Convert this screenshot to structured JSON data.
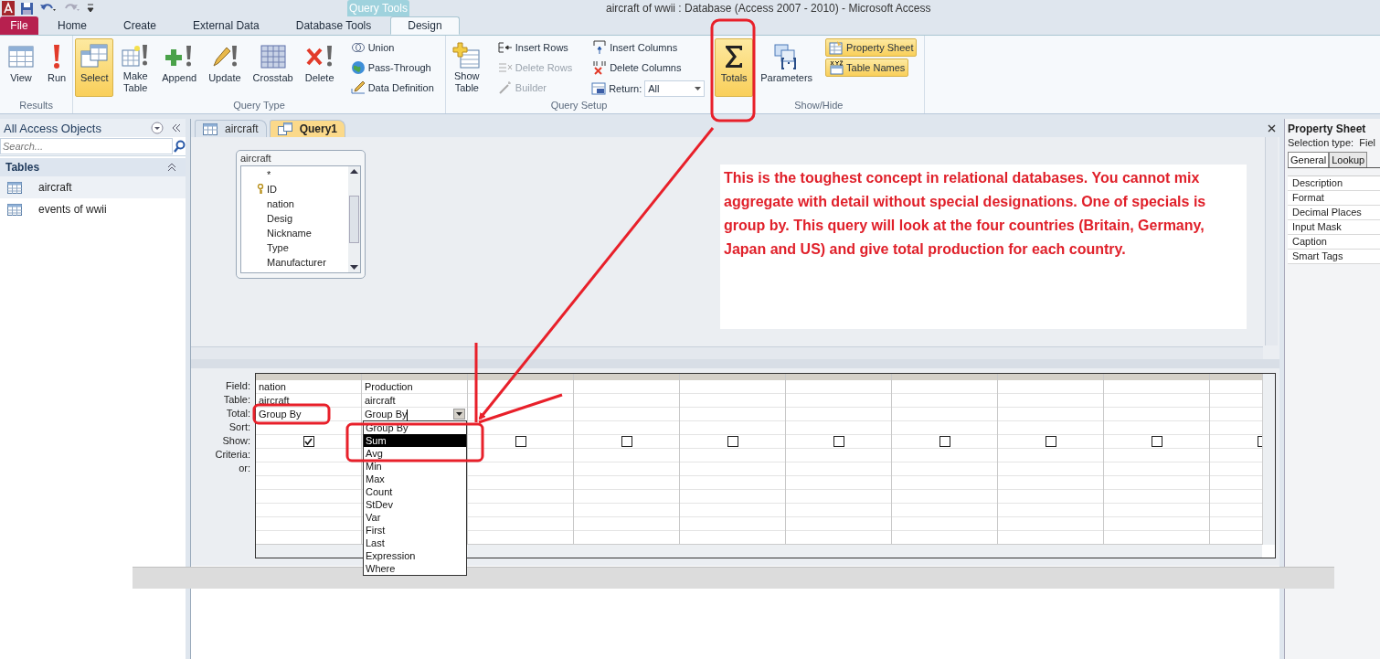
{
  "title_bar": {
    "contextual_tab": "Query Tools",
    "title": "aircraft of wwii : Database (Access 2007 - 2010)  -  Microsoft Access"
  },
  "ribbon_tabs": [
    {
      "label": "File",
      "kind": "file",
      "selected": false
    },
    {
      "label": "Home",
      "kind": "tab",
      "selected": false
    },
    {
      "label": "Create",
      "kind": "tab",
      "selected": false
    },
    {
      "label": "External Data",
      "kind": "tab",
      "selected": false
    },
    {
      "label": "Database Tools",
      "kind": "tab",
      "selected": false
    },
    {
      "label": "Design",
      "kind": "tab",
      "selected": true
    }
  ],
  "ribbon_groups": [
    {
      "label": "Results",
      "large": [
        {
          "label": "View",
          "on": false
        },
        {
          "label": "Run",
          "on": false
        }
      ]
    },
    {
      "label": "Query Type",
      "large": [
        {
          "label": "Select",
          "on": true
        },
        {
          "label": "Make Table",
          "on": false
        },
        {
          "label": "Append",
          "on": false
        },
        {
          "label": "Update",
          "on": false
        },
        {
          "label": "Crosstab",
          "on": false
        },
        {
          "label": "Delete",
          "on": false
        }
      ],
      "small": [
        {
          "label": "Union",
          "on": false,
          "disabled": false
        },
        {
          "label": "Pass-Through",
          "on": false,
          "disabled": false
        },
        {
          "label": "Data Definition",
          "on": false,
          "disabled": false
        }
      ]
    },
    {
      "label": "Query Setup",
      "large": [
        {
          "label": "Show Table",
          "on": false
        }
      ],
      "small": [
        {
          "label": "Insert Rows",
          "on": false,
          "disabled": false
        },
        {
          "label": "Delete Rows",
          "on": false,
          "disabled": true
        },
        {
          "label": "Builder",
          "on": false,
          "disabled": true
        },
        {
          "label": "Insert Columns",
          "on": false,
          "disabled": false
        },
        {
          "label": "Delete Columns",
          "on": false,
          "disabled": false
        }
      ],
      "return_field": {
        "label": "Return:",
        "value": "All"
      }
    },
    {
      "label": "Show/Hide",
      "large": [
        {
          "label": "Totals",
          "on": true
        },
        {
          "label": "Parameters",
          "on": false
        }
      ],
      "small": [
        {
          "label": "Property Sheet",
          "on": true,
          "disabled": false
        },
        {
          "label": "Table Names",
          "on": true,
          "disabled": false
        }
      ]
    }
  ],
  "nav_pane": {
    "title": "All Access Objects",
    "search": {
      "placeholder": "Search..."
    },
    "group": "Tables",
    "items": [
      {
        "label": "aircraft",
        "selected": true
      },
      {
        "label": "events of wwii",
        "selected": false
      }
    ]
  },
  "document_tabs": [
    {
      "label": "aircraft",
      "kind": "table",
      "selected": false
    },
    {
      "label": "Query1",
      "kind": "query",
      "selected": true
    }
  ],
  "table_box": {
    "title": "aircraft",
    "fields": [
      {
        "name": "*",
        "key": false
      },
      {
        "name": "ID",
        "key": true
      },
      {
        "name": "nation",
        "key": false
      },
      {
        "name": "Desig",
        "key": false
      },
      {
        "name": "Nickname",
        "key": false
      },
      {
        "name": "Type",
        "key": false
      },
      {
        "name": "Manufacturer",
        "key": false
      }
    ]
  },
  "note": "This is the toughest concept in relational databases. You cannot mix aggregate with detail without special designations. One of specials is group by. This query will look at the four countries (Britain, Germany, Japan and US) and give total production for each country.",
  "grid": {
    "row_labels": [
      "Field:",
      "Table:",
      "Total:",
      "Sort:",
      "Show:",
      "Criteria:",
      "or:"
    ],
    "columns": [
      {
        "field": "nation",
        "table": "aircraft",
        "total": "Group By",
        "show": true
      },
      {
        "field": "Production",
        "table": "aircraft",
        "total": "Group By",
        "dropdown": [
          {
            "label": "Group By",
            "selected": false
          },
          {
            "label": "Sum",
            "selected": true
          },
          {
            "label": "Avg",
            "selected": false
          },
          {
            "label": "Min",
            "selected": false
          },
          {
            "label": "Max",
            "selected": false
          },
          {
            "label": "Count",
            "selected": false
          },
          {
            "label": "StDev",
            "selected": false
          },
          {
            "label": "Var",
            "selected": false
          },
          {
            "label": "First",
            "selected": false
          },
          {
            "label": "Last",
            "selected": false
          },
          {
            "label": "Expression",
            "selected": false
          },
          {
            "label": "Where",
            "selected": false
          }
        ]
      },
      {
        "show": false
      },
      {
        "show": false
      },
      {
        "show": false
      },
      {
        "show": false
      },
      {
        "show": false
      },
      {
        "show": false
      },
      {
        "show": false
      },
      {
        "show": false
      }
    ]
  },
  "property_sheet": {
    "title": "Property Sheet",
    "selection_type": "Selection type:  Fiel",
    "tabs": [
      {
        "label": "General",
        "selected": true
      },
      {
        "label": "Lookup",
        "selected": false
      }
    ],
    "properties": [
      "Description",
      "Format",
      "Decimal Places",
      "Input Mask",
      "Caption",
      "Smart Tags"
    ]
  }
}
